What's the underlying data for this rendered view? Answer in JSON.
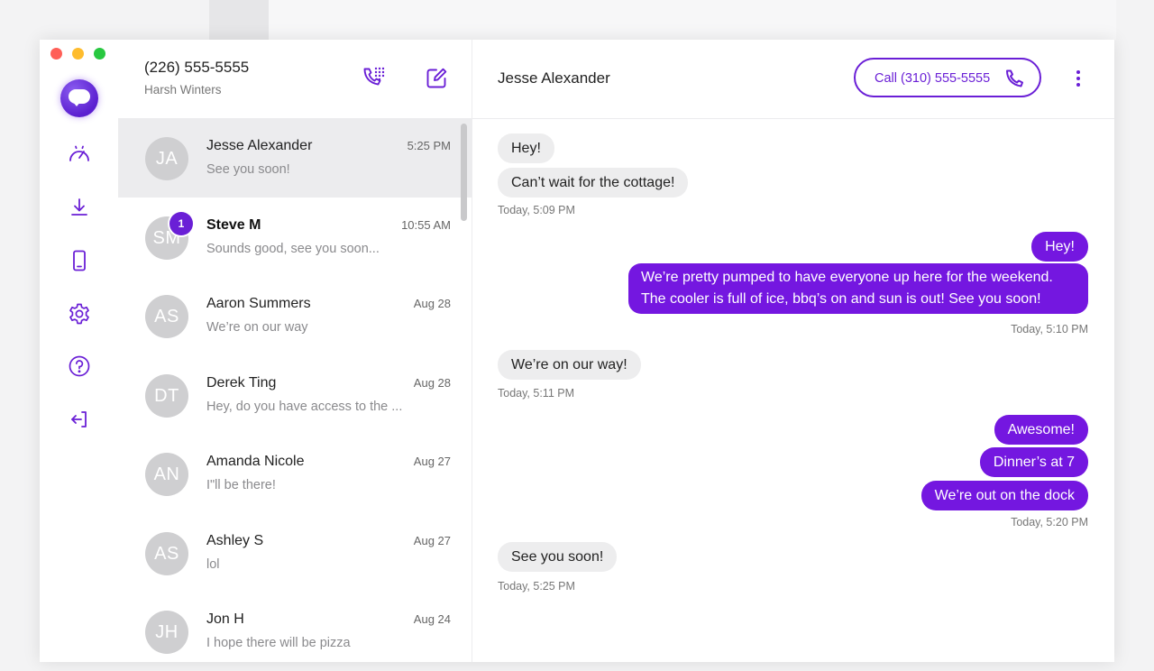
{
  "window": {
    "traffic_lights": [
      "#ff5f57",
      "#febc2e",
      "#28c840"
    ]
  },
  "accent_color": "#6a1fd6",
  "rail": {
    "items": [
      {
        "icon": "dashboard-icon"
      },
      {
        "icon": "download-icon"
      },
      {
        "icon": "phone-device-icon"
      },
      {
        "icon": "settings-icon"
      },
      {
        "icon": "help-icon"
      },
      {
        "icon": "logout-icon"
      }
    ]
  },
  "account": {
    "number": "(226) 555-5555",
    "name": "Harsh Winters"
  },
  "conversations": [
    {
      "initials": "JA",
      "name": "Jesse Alexander",
      "time": "5:25 PM",
      "preview": "See you soon!",
      "active": true
    },
    {
      "initials": "SM",
      "name": "Steve M",
      "time": "10:55 AM",
      "preview": "Sounds good, see you soon...",
      "unread": "1"
    },
    {
      "initials": "AS",
      "name": "Aaron Summers",
      "time": "Aug 28",
      "preview": "We’re on our way"
    },
    {
      "initials": "DT",
      "name": "Derek Ting",
      "time": "Aug 28",
      "preview": "Hey, do you have access to the ..."
    },
    {
      "initials": "AN",
      "name": "Amanda Nicole",
      "time": "Aug 27",
      "preview": "I\"ll be there!"
    },
    {
      "initials": "AS",
      "name": "Ashley S",
      "time": "Aug 27",
      "preview": "lol"
    },
    {
      "initials": "JH",
      "name": "Jon H",
      "time": "Aug 24",
      "preview": "I hope there will be pizza"
    }
  ],
  "thread": {
    "contact_name": "Jesse Alexander",
    "call_label": "Call  (310) 555-5555",
    "messages": [
      {
        "dir": "in",
        "text": "Hey!"
      },
      {
        "dir": "in",
        "text": "Can’t wait for the cottage!"
      },
      {
        "dir": "in",
        "stamp": "Today, 5:09 PM"
      },
      {
        "dir": "out",
        "text": "Hey!"
      },
      {
        "dir": "out",
        "text": "We’re pretty pumped to have everyone up here for the weekend. The cooler is full of ice, bbq’s on and sun is out!  See you soon!"
      },
      {
        "dir": "out",
        "stamp": "Today, 5:10 PM"
      },
      {
        "dir": "in",
        "text": "We’re on our way!"
      },
      {
        "dir": "in",
        "stamp": "Today, 5:11 PM"
      },
      {
        "dir": "out",
        "text": "Awesome!"
      },
      {
        "dir": "out",
        "text": "Dinner’s at 7"
      },
      {
        "dir": "out",
        "text": "We’re out on the dock"
      },
      {
        "dir": "out",
        "stamp": "Today, 5:20 PM"
      },
      {
        "dir": "in",
        "text": "See you soon!"
      },
      {
        "dir": "in",
        "stamp": "Today, 5:25 PM"
      }
    ]
  }
}
